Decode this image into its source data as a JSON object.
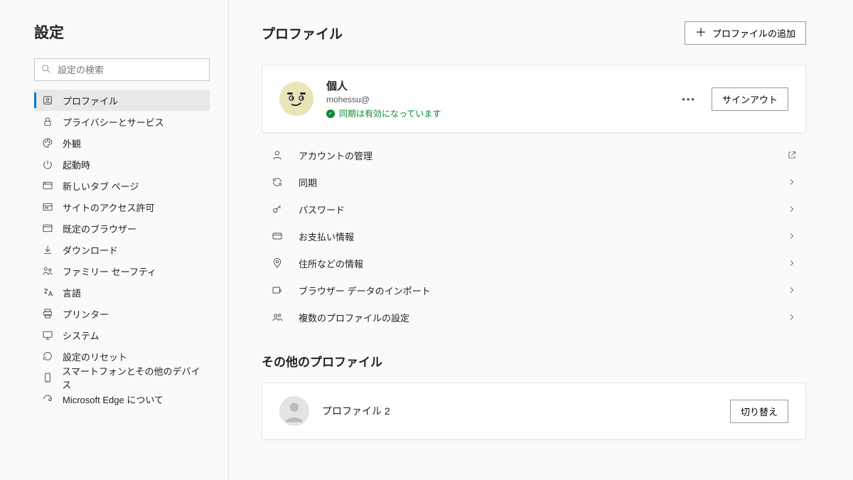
{
  "sidebar": {
    "title": "設定",
    "search_placeholder": "設定の検索",
    "items": [
      {
        "label": "プロファイル"
      },
      {
        "label": "プライバシーとサービス"
      },
      {
        "label": "外観"
      },
      {
        "label": "起動時"
      },
      {
        "label": "新しいタブ ページ"
      },
      {
        "label": "サイトのアクセス許可"
      },
      {
        "label": "既定のブラウザー"
      },
      {
        "label": "ダウンロード"
      },
      {
        "label": "ファミリー セーフティ"
      },
      {
        "label": "言語"
      },
      {
        "label": "プリンター"
      },
      {
        "label": "システム"
      },
      {
        "label": "設定のリセット"
      },
      {
        "label": "スマートフォンとその他のデバイス"
      },
      {
        "label": "Microsoft Edge について"
      }
    ]
  },
  "header": {
    "title": "プロファイル",
    "add_button": "プロファイルの追加"
  },
  "profile": {
    "name": "個人",
    "email": "mohessu@",
    "sync_status": "同期は有効になっています",
    "signout": "サインアウト"
  },
  "options": [
    {
      "label": "アカウントの管理",
      "trail": "external"
    },
    {
      "label": "同期",
      "trail": "chevron"
    },
    {
      "label": "パスワード",
      "trail": "chevron"
    },
    {
      "label": "お支払い情報",
      "trail": "chevron"
    },
    {
      "label": "住所などの情報",
      "trail": "chevron"
    },
    {
      "label": "ブラウザー データのインポート",
      "trail": "chevron"
    },
    {
      "label": "複数のプロファイルの設定",
      "trail": "chevron"
    }
  ],
  "other": {
    "title": "その他のプロファイル",
    "profile2": {
      "name": "プロファイル 2",
      "switch": "切り替え"
    }
  }
}
